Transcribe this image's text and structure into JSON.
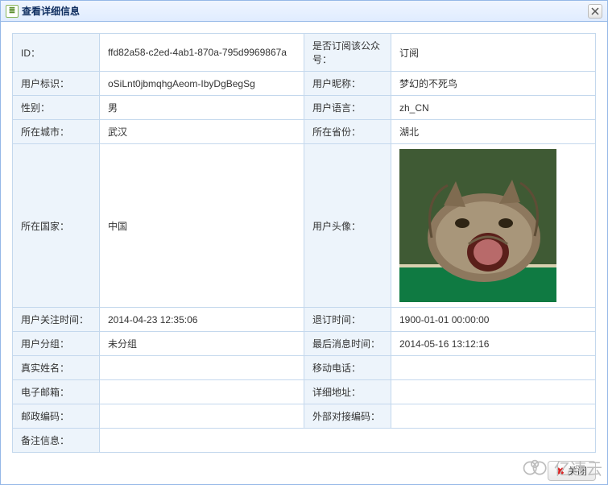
{
  "dialog": {
    "title": "查看详细信息"
  },
  "fields": {
    "id_label": "ID：",
    "id_value": "ffd82a58-c2ed-4ab1-870a-795d9969867a",
    "subscribed_label": "是否订阅该公众号：",
    "subscribed_value": "订阅",
    "userident_label": "用户标识：",
    "userident_value": "oSiLnt0jbmqhgAeom-IbyDgBegSg",
    "nickname_label": "用户昵称：",
    "nickname_value": "梦幻的不死鸟",
    "gender_label": "性别：",
    "gender_value": "男",
    "lang_label": "用户语言：",
    "lang_value": "zh_CN",
    "city_label": "所在城市：",
    "city_value": "武汉",
    "province_label": "所在省份：",
    "province_value": "湖北",
    "country_label": "所在国家：",
    "country_value": "中国",
    "avatar_label": "用户头像：",
    "followtime_label": "用户关注时间：",
    "followtime_value": "2014-04-23 12:35:06",
    "unsubtime_label": "退订时间：",
    "unsubtime_value": "1900-01-01 00:00:00",
    "group_label": "用户分组：",
    "group_value": "未分组",
    "lastmsg_label": "最后消息时间：",
    "lastmsg_value": "2014-05-16 13:12:16",
    "realname_label": "真实姓名：",
    "realname_value": "",
    "mobile_label": "移动电话：",
    "mobile_value": "",
    "email_label": "电子邮箱：",
    "email_value": "",
    "address_label": "详细地址：",
    "address_value": "",
    "postcode_label": "邮政编码：",
    "postcode_value": "",
    "extcode_label": "外部对接编码：",
    "extcode_value": "",
    "remark_label": "备注信息：",
    "remark_value": ""
  },
  "buttons": {
    "close": "关闭"
  },
  "watermark": "亿速云"
}
